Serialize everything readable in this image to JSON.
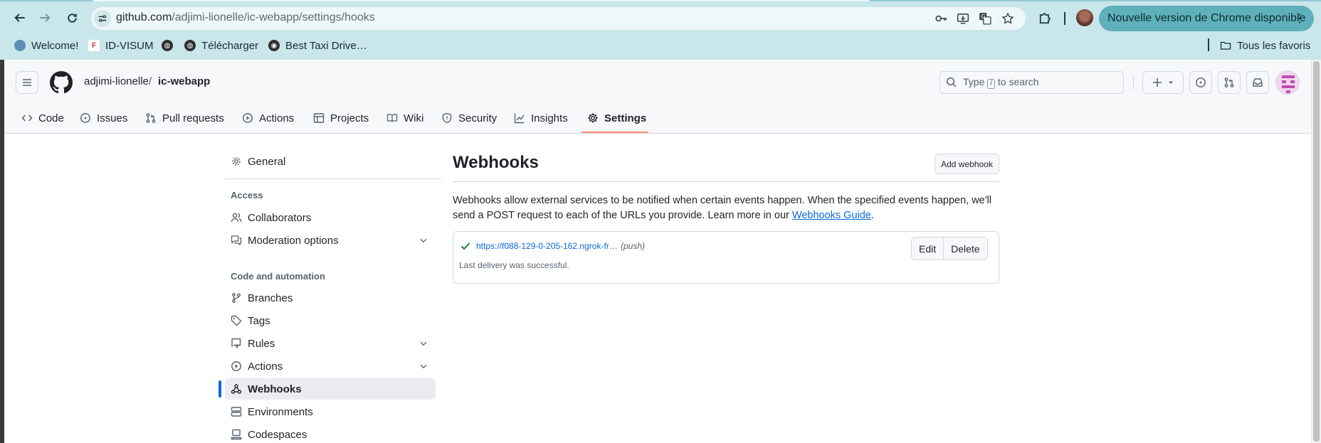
{
  "browser": {
    "url_host": "github.com",
    "url_path": "/adjimi-lionelle/ic-webapp/settings/hooks",
    "update_label": "Nouvelle version de Chrome disponible",
    "bookmarks": [
      {
        "label": "Welcome!",
        "icon": "welcome-favicon"
      },
      {
        "label": "ID-VISUM",
        "icon": "id-visum-favicon"
      },
      {
        "label": "",
        "icon": "globe-favicon"
      },
      {
        "label": "Télécharger",
        "icon": "globe-favicon"
      },
      {
        "label": "Best Taxi Drive…",
        "icon": "taxi-favicon"
      }
    ],
    "all_bookmarks_label": "Tous les favoris"
  },
  "header": {
    "owner": "adjimi-lionelle",
    "separator": "/",
    "repo": "ic-webapp",
    "search_prefix": "Type",
    "search_key": "/",
    "search_suffix": "to search"
  },
  "repo_nav": [
    {
      "label": "Code",
      "icon": "code-icon"
    },
    {
      "label": "Issues",
      "icon": "issue-icon"
    },
    {
      "label": "Pull requests",
      "icon": "pull-request-icon"
    },
    {
      "label": "Actions",
      "icon": "play-icon"
    },
    {
      "label": "Projects",
      "icon": "table-icon"
    },
    {
      "label": "Wiki",
      "icon": "book-icon"
    },
    {
      "label": "Security",
      "icon": "shield-icon"
    },
    {
      "label": "Insights",
      "icon": "graph-icon"
    },
    {
      "label": "Settings",
      "icon": "gear-icon",
      "active": true
    }
  ],
  "sidebar": {
    "general": "General",
    "access_heading": "Access",
    "access_items": [
      "Collaborators",
      "Moderation options"
    ],
    "code_heading": "Code and automation",
    "code_items": [
      "Branches",
      "Tags",
      "Rules",
      "Actions",
      "Webhooks",
      "Environments",
      "Codespaces"
    ],
    "active": "Webhooks"
  },
  "main": {
    "title": "Webhooks",
    "add_button": "Add webhook",
    "description_before": "Webhooks allow external services to be notified when certain events happen. When the specified events happen, we'll send a POST request to each of the URLs you provide. Learn more in our ",
    "description_link": "Webhooks Guide",
    "description_after": ".",
    "hooks": [
      {
        "url": "https://f088-129-0-205-162.ngrok-fr…",
        "event": "(push)",
        "status": "Last delivery was successful.",
        "edit_label": "Edit",
        "delete_label": "Delete"
      }
    ]
  },
  "colors": {
    "chrome_bar": "#c9e6eb",
    "update_chip": "#5eb1bb",
    "link": "#0969da",
    "success": "#1a7f37",
    "active_underline": "#fd8c73",
    "active_bar": "#0969da"
  }
}
